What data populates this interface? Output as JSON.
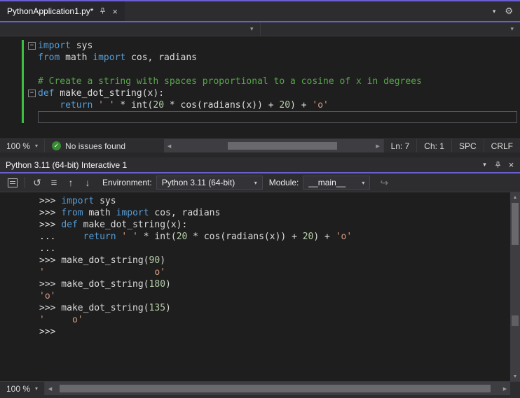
{
  "colors": {
    "accent_purple": "#6a5fd0",
    "keyword_blue": "#569cd6",
    "comment_green": "#57a64a",
    "string_orange": "#d69d85",
    "number_green": "#b5cea8",
    "issues_green": "#388a34",
    "change_green": "#3fbf3f"
  },
  "icons": {
    "close": "×",
    "chevron_down": "▾",
    "gear": "⚙",
    "check": "✓",
    "collapse": "−",
    "arrow_left": "◀",
    "arrow_right": "▶",
    "arrow_up": "▲",
    "arrow_down": "▼",
    "history_prev": "↑",
    "history_next": "↓",
    "reset": "↺",
    "clear_screen": "≡",
    "send": "↪"
  },
  "editor": {
    "tab_title": "PythonApplication1.py*",
    "status": {
      "zoom": "100 %",
      "issues": "No issues found",
      "line": "Ln: 7",
      "column": "Ch: 1",
      "spaces": "SPC",
      "line_ending": "CRLF"
    },
    "lines": [
      {
        "fold": true,
        "changed": true,
        "tokens": [
          {
            "c": "kw",
            "t": "import"
          },
          {
            "c": "pl",
            "t": " sys"
          }
        ]
      },
      {
        "changed": true,
        "tokens": [
          {
            "c": "kw",
            "t": "from"
          },
          {
            "c": "pl",
            "t": " math "
          },
          {
            "c": "kw",
            "t": "import"
          },
          {
            "c": "pl",
            "t": " cos, radians"
          }
        ]
      },
      {
        "changed": true,
        "tokens": []
      },
      {
        "changed": true,
        "tokens": [
          {
            "c": "com",
            "t": "# Create a string with spaces proportional to a cosine of x in degrees"
          }
        ]
      },
      {
        "fold": true,
        "changed": true,
        "tokens": [
          {
            "c": "kw",
            "t": "def"
          },
          {
            "c": "pl",
            "t": " make_dot_string(x):"
          }
        ]
      },
      {
        "changed": true,
        "tokens": [
          {
            "c": "pl",
            "t": "    "
          },
          {
            "c": "kw",
            "t": "return"
          },
          {
            "c": "pl",
            "t": " "
          },
          {
            "c": "str",
            "t": "' '"
          },
          {
            "c": "pl",
            "t": " * int("
          },
          {
            "c": "num",
            "t": "20"
          },
          {
            "c": "pl",
            "t": " * cos(radians(x)) + "
          },
          {
            "c": "num",
            "t": "20"
          },
          {
            "c": "pl",
            "t": ") + "
          },
          {
            "c": "str",
            "t": "'o'"
          }
        ]
      },
      {
        "changed": true,
        "current": true,
        "tokens": []
      }
    ]
  },
  "interactive": {
    "title": "Python 3.11 (64-bit) Interactive 1",
    "toolbar": {
      "environment_label": "Environment:",
      "environment_value": "Python 3.11 (64-bit)",
      "module_label": "Module:",
      "module_value": "__main__"
    },
    "status": {
      "zoom": "100 %"
    },
    "lines": [
      {
        "tokens": [
          {
            "c": "pl",
            "t": ">>> "
          },
          {
            "c": "kw",
            "t": "import"
          },
          {
            "c": "pl",
            "t": " sys"
          }
        ]
      },
      {
        "tokens": [
          {
            "c": "pl",
            "t": ">>> "
          },
          {
            "c": "kw",
            "t": "from"
          },
          {
            "c": "pl",
            "t": " math "
          },
          {
            "c": "kw",
            "t": "import"
          },
          {
            "c": "pl",
            "t": " cos, radians"
          }
        ]
      },
      {
        "tokens": [
          {
            "c": "pl",
            "t": ">>> "
          },
          {
            "c": "kw",
            "t": "def"
          },
          {
            "c": "pl",
            "t": " make_dot_string(x):"
          }
        ]
      },
      {
        "tokens": [
          {
            "c": "pl",
            "t": "...     "
          },
          {
            "c": "kw",
            "t": "return"
          },
          {
            "c": "pl",
            "t": " "
          },
          {
            "c": "str",
            "t": "' '"
          },
          {
            "c": "pl",
            "t": " * int("
          },
          {
            "c": "num",
            "t": "20"
          },
          {
            "c": "pl",
            "t": " * cos(radians(x)) + "
          },
          {
            "c": "num",
            "t": "20"
          },
          {
            "c": "pl",
            "t": ") + "
          },
          {
            "c": "str",
            "t": "'o'"
          }
        ]
      },
      {
        "tokens": [
          {
            "c": "pl",
            "t": "..."
          }
        ]
      },
      {
        "tokens": [
          {
            "c": "pl",
            "t": ">>> make_dot_string("
          },
          {
            "c": "num",
            "t": "90"
          },
          {
            "c": "pl",
            "t": ")"
          }
        ]
      },
      {
        "tokens": [
          {
            "c": "str",
            "t": "'                    o'"
          }
        ]
      },
      {
        "tokens": [
          {
            "c": "pl",
            "t": ">>> make_dot_string("
          },
          {
            "c": "num",
            "t": "180"
          },
          {
            "c": "pl",
            "t": ")"
          }
        ]
      },
      {
        "tokens": [
          {
            "c": "str",
            "t": "'o'"
          }
        ]
      },
      {
        "tokens": [
          {
            "c": "pl",
            "t": ">>> make_dot_string("
          },
          {
            "c": "num",
            "t": "135"
          },
          {
            "c": "pl",
            "t": ")"
          }
        ]
      },
      {
        "tokens": [
          {
            "c": "str",
            "t": "'     o'"
          }
        ]
      },
      {
        "tokens": [
          {
            "c": "pl",
            "t": ">>> "
          }
        ]
      }
    ]
  }
}
